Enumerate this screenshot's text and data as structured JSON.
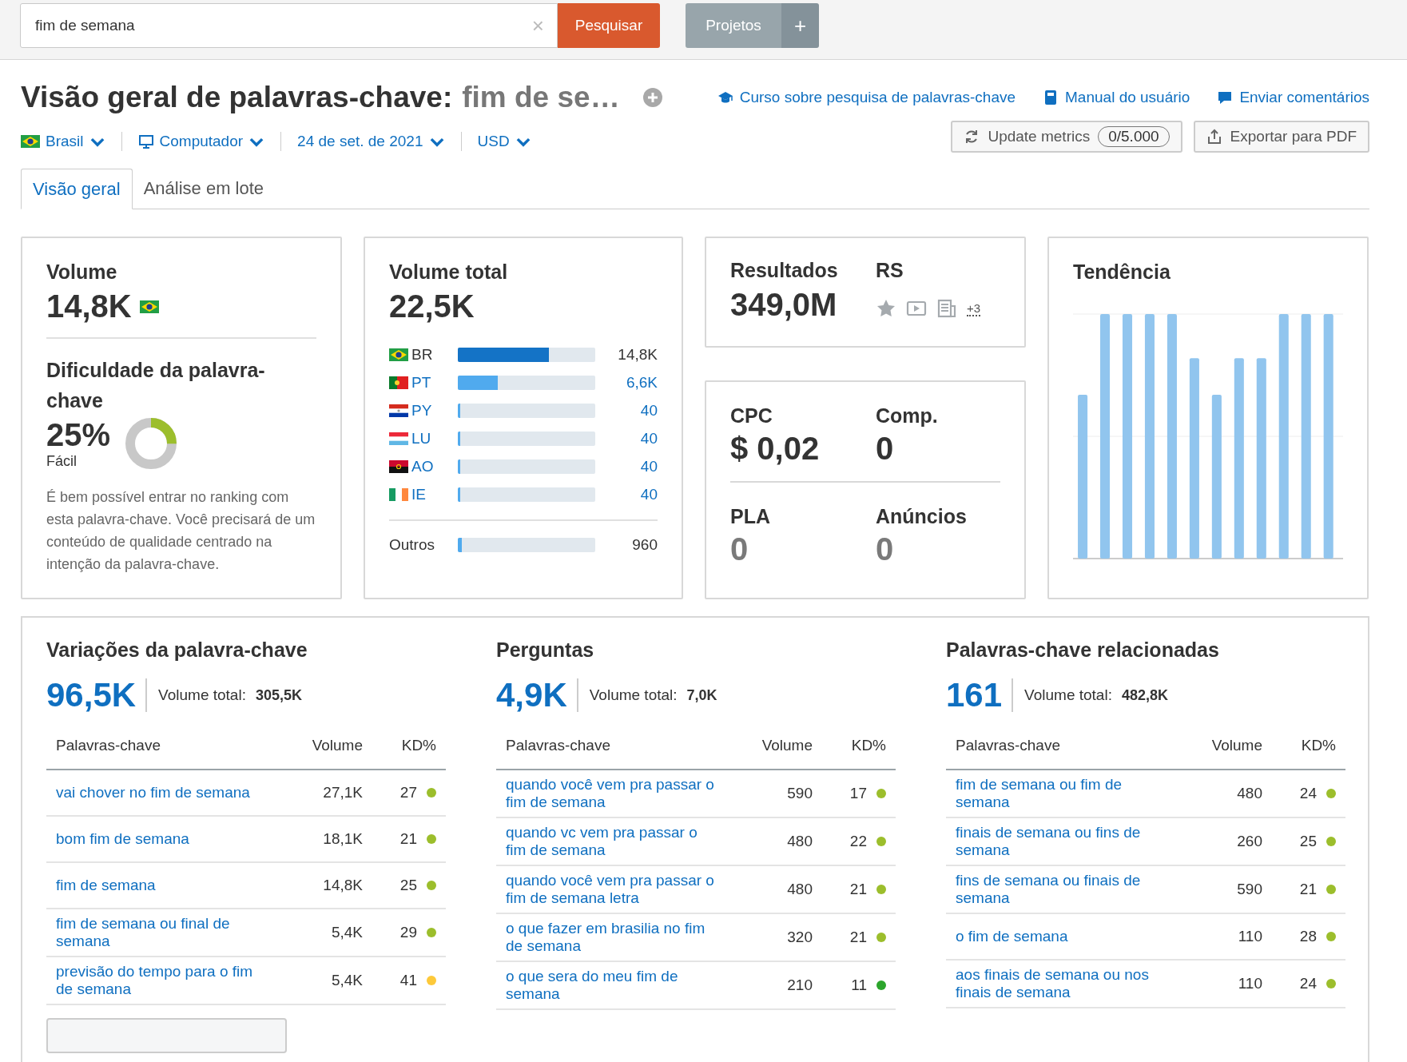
{
  "search": {
    "value": "fim de semana",
    "clear": "×",
    "button": "Pesquisar"
  },
  "projects": {
    "label": "Projetos",
    "add": "+"
  },
  "header": {
    "title": "Visão geral de palavras-chave:",
    "keyword": "fim de se…",
    "links": [
      {
        "kind": "course",
        "label": "Curso sobre pesquisa de palavras-chave"
      },
      {
        "kind": "manual",
        "label": "Manual do usuário"
      },
      {
        "kind": "feedback",
        "label": "Enviar comentários"
      }
    ]
  },
  "filters": [
    {
      "kind": "flag",
      "label": "Brasil"
    },
    {
      "kind": "device",
      "label": "Computador"
    },
    {
      "kind": "plain",
      "label": "24 de set. de 2021"
    },
    {
      "kind": "plain",
      "label": "USD"
    }
  ],
  "actions": {
    "update": {
      "label": "Update metrics",
      "counter": "0/5.000"
    },
    "export": "Exportar para PDF"
  },
  "tabs": [
    {
      "label": "Visão geral",
      "selected": true
    },
    {
      "label": "Análise em lote",
      "selected": false
    }
  ],
  "volume_card": {
    "title": "Volume",
    "value": "14,8K",
    "difficulty_title": "Dificuldade da palavra-chave",
    "difficulty": "25%",
    "level": 0.25,
    "difficulty_label": "Fácil",
    "description": "É bem possível entrar no ranking com esta palavra-chave. Você precisará de um conteúdo de qualidade centrado na intenção da palavra-chave."
  },
  "total_card": {
    "title": "Volume total",
    "value": "22,5K",
    "countries": [
      {
        "kind": "br",
        "code": "BR",
        "value": "14,8K",
        "level": 0.66,
        "current": true
      },
      {
        "kind": "pt",
        "code": "PT",
        "value": "6,6K",
        "level": 0.29,
        "current": false
      },
      {
        "kind": "py",
        "code": "PY",
        "value": "40",
        "level": 0.02,
        "current": false
      },
      {
        "kind": "lu",
        "code": "LU",
        "value": "40",
        "level": 0.02,
        "current": false
      },
      {
        "kind": "ao",
        "code": "AO",
        "value": "40",
        "level": 0.02,
        "current": false
      },
      {
        "kind": "ie",
        "code": "IE",
        "value": "40",
        "level": 0.02,
        "current": false
      }
    ],
    "others": {
      "label": "Outros",
      "value": "960",
      "level": 0.03
    }
  },
  "results_card": {
    "title": "Resultados",
    "value": "349,0M",
    "features_title": "RS",
    "features": [
      {
        "kind": "star"
      },
      {
        "kind": "video"
      },
      {
        "kind": "news"
      }
    ],
    "more": "+3"
  },
  "cpc_card": {
    "metrics": [
      {
        "label": "CPC",
        "value": "$ 0,02",
        "muted": false
      },
      {
        "label": "Comp.",
        "value": "0",
        "muted": false
      },
      {
        "label": "PLA",
        "value": "0",
        "muted": true
      },
      {
        "label": "Anúncios",
        "value": "0",
        "muted": true
      }
    ]
  },
  "trend_card": {
    "title": "Tendência"
  },
  "sections": [
    {
      "title": "Variações da palavra-chave",
      "count": "96,5K",
      "total_label": "Volume total:",
      "total": "305,5K",
      "columns": [
        "Palavras-chave",
        "Volume",
        "KD%"
      ],
      "rows": [
        {
          "keyword": "vai chover no fim de semana",
          "volume": "27,1K",
          "kd": "27",
          "color": "#9cbe2c"
        },
        {
          "keyword": "bom fim de semana",
          "volume": "18,1K",
          "kd": "21",
          "color": "#9cbe2c"
        },
        {
          "keyword": "fim de semana",
          "volume": "14,8K",
          "kd": "25",
          "color": "#9cbe2c"
        },
        {
          "keyword": "fim de semana ou final de semana",
          "volume": "5,4K",
          "kd": "29",
          "color": "#9cbe2c"
        },
        {
          "keyword": "previsão do tempo para o fim de semana",
          "volume": "5,4K",
          "kd": "41",
          "color": "#fdc93a"
        }
      ],
      "more_button": true
    },
    {
      "title": "Perguntas",
      "count": "4,9K",
      "total_label": "Volume total:",
      "total": "7,0K",
      "columns": [
        "Palavras-chave",
        "Volume",
        "KD%"
      ],
      "rows": [
        {
          "keyword": "quando você vem pra passar o fim de semana",
          "volume": "590",
          "kd": "17",
          "color": "#9cbe2c"
        },
        {
          "keyword": "quando vc vem pra passar o fim de semana",
          "volume": "480",
          "kd": "22",
          "color": "#9cbe2c"
        },
        {
          "keyword": "quando você vem pra passar o fim de semana letra",
          "volume": "480",
          "kd": "21",
          "color": "#9cbe2c"
        },
        {
          "keyword": "o que fazer em brasilia no fim de semana",
          "volume": "320",
          "kd": "21",
          "color": "#9cbe2c"
        },
        {
          "keyword": "o que sera do meu fim de semana",
          "volume": "210",
          "kd": "11",
          "color": "#2ca52c"
        }
      ]
    },
    {
      "title": "Palavras-chave relacionadas",
      "count": "161",
      "total_label": "Volume total:",
      "total": "482,8K",
      "columns": [
        "Palavras-chave",
        "Volume",
        "KD%"
      ],
      "rows": [
        {
          "keyword": "fim de semana ou fim de semana",
          "volume": "480",
          "kd": "24",
          "color": "#9cbe2c"
        },
        {
          "keyword": "finais de semana ou fins de semana",
          "volume": "260",
          "kd": "25",
          "color": "#9cbe2c"
        },
        {
          "keyword": "fins de semana ou finais de semana",
          "volume": "590",
          "kd": "21",
          "color": "#9cbe2c"
        },
        {
          "keyword": "o fim de semana",
          "volume": "110",
          "kd": "28",
          "color": "#9cbe2c"
        },
        {
          "keyword": "aos finais de semana ou nos finais de semana",
          "volume": "110",
          "kd": "24",
          "color": "#9cbe2c"
        }
      ]
    }
  ]
}
